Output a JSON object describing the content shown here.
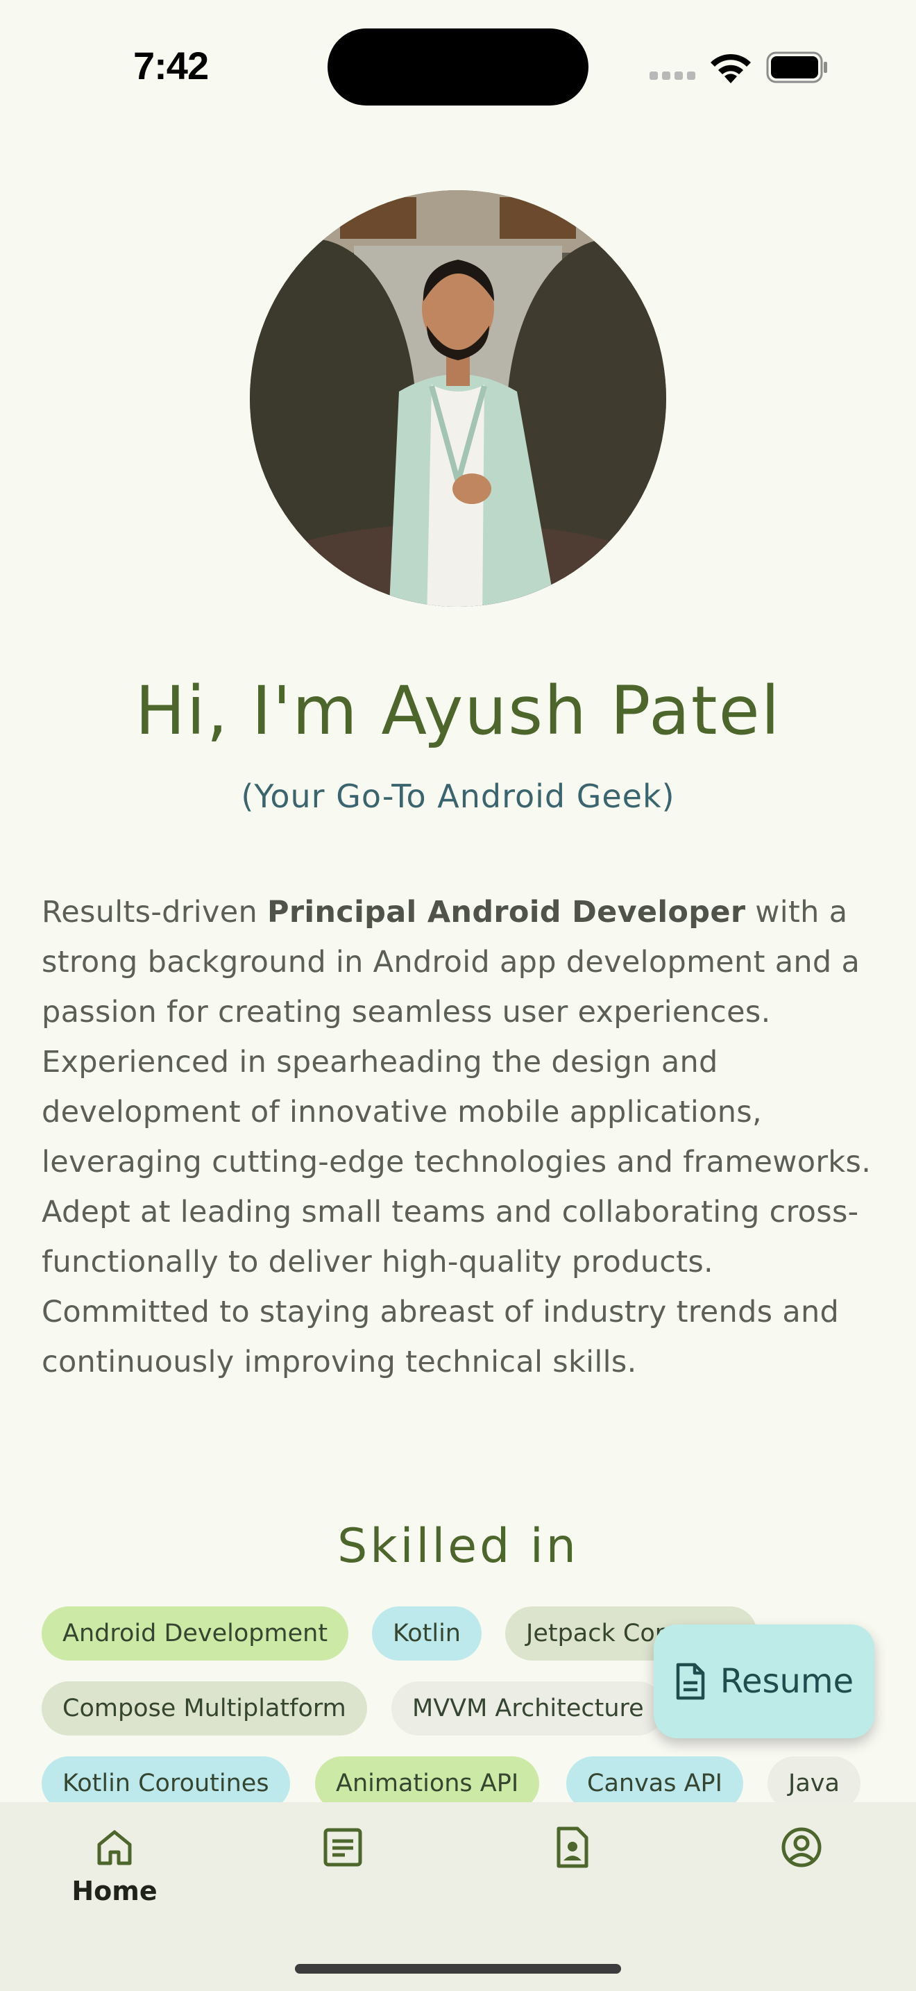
{
  "status_bar": {
    "time": "7:42"
  },
  "profile": {
    "greeting": "Hi, I'm Ayush Patel",
    "tagline": "(Your Go-To Android Geek)",
    "bio_before": "Results-driven ",
    "bio_bold": "Principal Android Developer",
    "bio_after": " with a strong background in Android app development and a passion for creating seamless user experiences. Experienced in spearheading the design and development of innovative mobile applications, leveraging cutting-edge technologies and frameworks. Adept at leading small teams and collaborating cross-functionally to deliver high-quality products. Committed to staying abreast of industry trends and continuously improving technical skills."
  },
  "skills": {
    "heading": "Skilled in",
    "chips": [
      "Android Development",
      "Kotlin",
      "Jetpack Compose",
      "Compose Multiplatform",
      "MVVM Architecture",
      "Kotlin Coroutines",
      "Animations API",
      "Canvas API",
      "Java"
    ]
  },
  "fab": {
    "label": "Resume",
    "icon": "document-icon"
  },
  "bottom_nav": {
    "items": [
      {
        "label": "Home",
        "icon": "home-icon",
        "selected": true
      },
      {
        "label": "",
        "icon": "article-icon",
        "selected": false
      },
      {
        "label": "",
        "icon": "contact-page-icon",
        "selected": false
      },
      {
        "label": "",
        "icon": "account-circle-icon",
        "selected": false
      }
    ]
  },
  "colors": {
    "background": "#f8f9f1",
    "primary": "#4c662b",
    "tertiary": "#3a656f",
    "chip_green": "#cde9a6",
    "chip_cyan": "#bde9ec",
    "chip_sage": "#dce4cd",
    "fab": "#bcebe8",
    "nav_background": "#edeee4"
  }
}
